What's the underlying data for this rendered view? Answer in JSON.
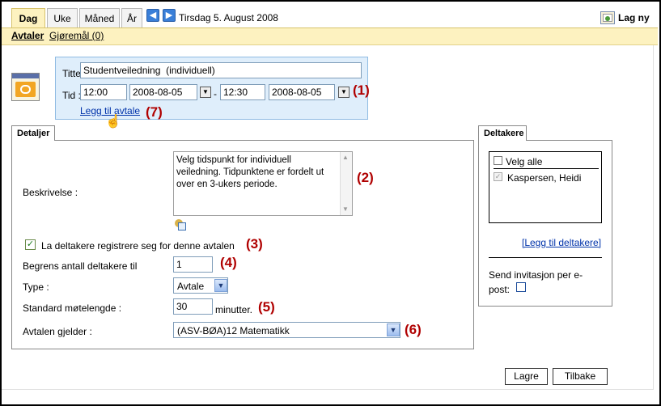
{
  "tabs": [
    {
      "label": "Dag"
    },
    {
      "label": "Uke"
    },
    {
      "label": "Måned"
    },
    {
      "label": "År"
    }
  ],
  "nav": {
    "prev_icon": "arrow-left-icon",
    "next_icon": "arrow-right-icon",
    "date_text": "Tirsdag 5. August 2008"
  },
  "new_button": {
    "label": "Lag ny",
    "icon": "new-appointment-icon"
  },
  "subtabs": {
    "appointments": "Avtaler",
    "todos": "Gjøremål (0)"
  },
  "appointment": {
    "title_label": "Tittel :",
    "title_value": "Studentveiledning  (individuell)",
    "time_label": "Tid :",
    "start_time": "12:00",
    "start_date": "2008-08-05",
    "dash": "-",
    "end_time": "12:30",
    "end_date": "2008-08-05",
    "add_link": "Legg til avtale",
    "icon": "calendar-icon"
  },
  "annotations": {
    "a1": "(1)",
    "a2": "(2)",
    "a3": "(3)",
    "a4": "(4)",
    "a5": "(5)",
    "a6": "(6)",
    "a7": "(7)"
  },
  "details": {
    "tab_label": "Detaljer",
    "description_label": "Beskrivelse :",
    "description_value": "Velg tidspunkt for individuell veiledning. Tidpunktene er fordelt ut over en 3-ukers periode.",
    "register_label": "La deltakere registrere seg for denne avtalen",
    "register_checked": true,
    "limit_label": "Begrens antall deltakere til",
    "limit_value": "1",
    "type_label": "Type :",
    "type_value": "Avtale",
    "length_label": "Standard møtelengde :",
    "length_value": "30",
    "length_unit": "minutter.",
    "applies_label": "Avtalen gjelder :",
    "applies_value": "(ASV-BØA)12 Matematikk"
  },
  "participants": {
    "tab_label": "Deltakere",
    "select_all": "Velg alle",
    "people": [
      {
        "name": "Kaspersen, Heidi",
        "checked": true
      }
    ],
    "add_link": "[Legg til deltakere]",
    "invite_label": "Send invitasjon per e-post:"
  },
  "buttons": {
    "save": "Lagre",
    "back": "Tilbake"
  }
}
